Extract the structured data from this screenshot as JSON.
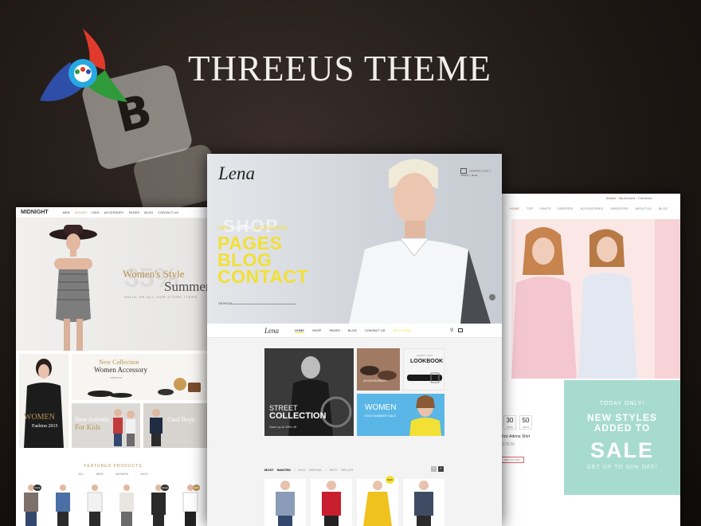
{
  "header": {
    "title": "THREEUS THEME",
    "logo_icon": "threeus-logo-icon"
  },
  "background": {
    "dice_letter": "B"
  },
  "midnight": {
    "brand": "MIDNIGHT",
    "nav": [
      "MEN",
      "WOMEN",
      "KIDS",
      "ACCESSORY",
      "PAGES",
      "BLOG",
      "CONTACT US"
    ],
    "nav_active": "WOMEN",
    "hero_line1": "Women's Style",
    "hero_line2": "Summer",
    "hero_big": "35%",
    "hero_valid": "VALID ON ALL OUR STORE ITEMS",
    "tile_women_title": "WOMEN",
    "tile_women_sub": "Fashion 2015",
    "tile_accessory_l1": "New Collection",
    "tile_accessory_l2": "Women Accessory",
    "tile_accessory_cta": "SHOP NOW",
    "tile_kids_l1": "New Arrivals",
    "tile_kids_l2": "For Kids",
    "tile_boys": "Cool Boys",
    "featured_title": "FEATURED PRODUCTS",
    "featured_tabs": "ALL  · MEN · WOMEN · KIDS",
    "badges": {
      "sale": "SALE",
      "new": "NEW"
    }
  },
  "lena": {
    "logo": "Lena",
    "cart_text": "SHOPPING CART 0 ITEM(S) - $0.00",
    "hero_shop": "SHOP",
    "hero_cats": {
      "men": "MEN",
      "women": "WOMEN",
      "accessories": "ACCESSORIES"
    },
    "hero_lines": [
      "PAGES",
      "BLOG",
      "CONTACT"
    ],
    "search_label": "SEARCH",
    "nav": [
      "HOME",
      "SHOP",
      "PAGES",
      "BLOG",
      "CONTACT US",
      "BUY THEME"
    ],
    "nav_active": "HOME",
    "block_street_l1": "STREET",
    "block_street_l2": "COLLECTION",
    "block_street_sub": "Save up to 25% off",
    "block_accessories": "ACCESSORIES",
    "block_lookbook_small": "SEARCH 2015",
    "block_lookbook": "LOOKBOOK",
    "block_women": "WOMEN",
    "block_women_sub": "2015 SUMMER SALE",
    "tabs": {
      "active": "MOST WANTED",
      "t2": "NEW ARRIVAL",
      "t3": "BEST SELLER"
    },
    "arrow_prev": "‹",
    "arrow_next": "›",
    "badge_new": "NEW"
  },
  "right": {
    "top_bar": "Search · My Account · Checkout",
    "nav": [
      "HOME",
      "TOP",
      "PANTS",
      "DRESSES",
      "ACCESSORIES",
      "SWEATERS",
      "ABOUT US",
      "BLOG"
    ],
    "nav_active": "HOME",
    "promo_today": "TODAY ONLY!",
    "promo_new": "NEW STYLES",
    "promo_added": "ADDED TO",
    "promo_sale": "SALE",
    "promo_upto": "GET UP TO 30% OFF!",
    "counter": [
      {
        "value": "30",
        "unit": "MINS"
      },
      {
        "value": "50",
        "unit": "SECS"
      }
    ],
    "product_name": "Rice Adena Shirt",
    "product_price": "$178.00",
    "product_button": "ADD TO CART"
  },
  "colors": {
    "accent_gold": "#b8924f",
    "lena_yellow": "#f2e034",
    "mint": "#a8dbcf",
    "coral": "#d66a6a"
  }
}
